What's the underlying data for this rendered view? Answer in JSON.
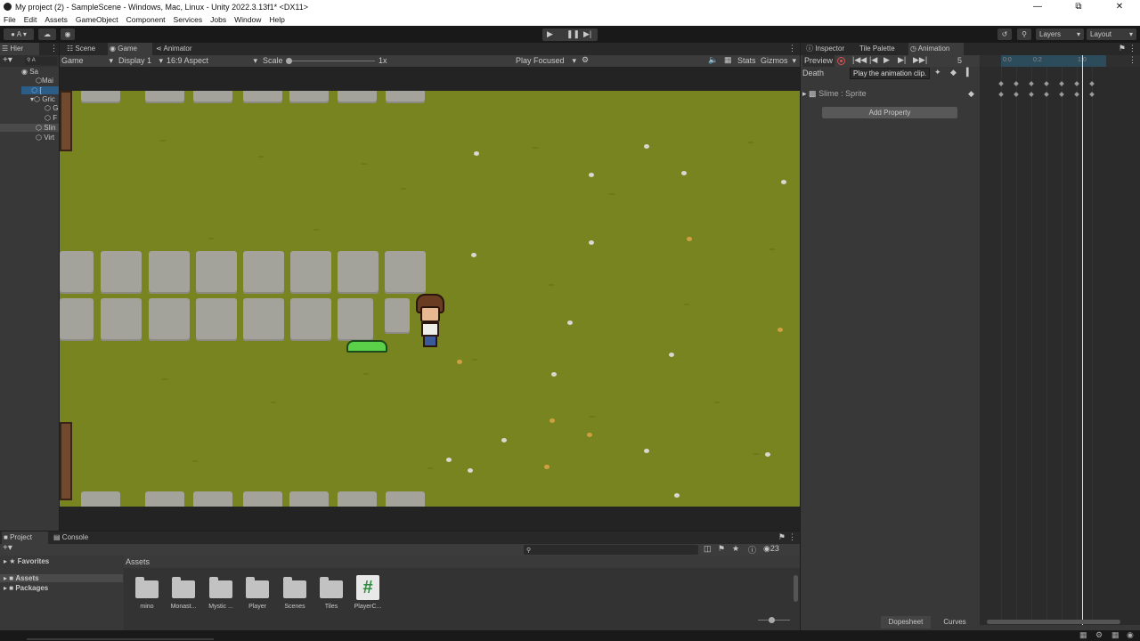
{
  "window": {
    "title": "My project (2) - SampleScene - Windows, Mac, Linux - Unity 2022.3.13f1* <DX11>",
    "minimize": "—",
    "maximize": "⧉",
    "close": "✕"
  },
  "menu": [
    "File",
    "Edit",
    "Assets",
    "GameObject",
    "Component",
    "Services",
    "Jobs",
    "Window",
    "Help"
  ],
  "toolbar": {
    "account_label": "A",
    "layers_label": "Layers",
    "layout_label": "Layout"
  },
  "hierarchy": {
    "tab_label": "Hier",
    "search_label": "A",
    "rows": [
      "Sa",
      "Mai",
      "[",
      "Gric",
      "G",
      "F",
      "Slin",
      "Virt"
    ]
  },
  "game_view": {
    "tabs": [
      "Scene",
      "Game",
      "Animator"
    ],
    "mode_label": "Game",
    "display_label": "Display 1",
    "aspect_label": "16:9 Aspect",
    "scale_label": "Scale",
    "scale_value": "1x",
    "play_focused_label": "Play Focused",
    "stats_label": "Stats",
    "gizmos_label": "Gizmos"
  },
  "animation": {
    "tabs": [
      "Inspector",
      "Tile Palette",
      "Animation"
    ],
    "preview_label": "Preview",
    "frame_value": "5",
    "clip_name": "Death",
    "tooltip": "Play the animation clip.",
    "property_label": "Slime : Sprite",
    "add_property_label": "Add Property",
    "timeline_ticks": [
      "0:0",
      "0:2",
      "1:0"
    ],
    "dopesheet_label": "Dopesheet",
    "curves_label": "Curves"
  },
  "project": {
    "tabs": [
      "Project",
      "Console"
    ],
    "favorites_label": "Favorites",
    "assets_label": "Assets",
    "packages_label": "Packages",
    "breadcrumb": "Assets",
    "hidden_count": "23",
    "items": [
      {
        "label": "mino",
        "type": "folder"
      },
      {
        "label": "Monast...",
        "type": "folder"
      },
      {
        "label": "Mystic ...",
        "type": "folder"
      },
      {
        "label": "Player",
        "type": "folder"
      },
      {
        "label": "Scenes",
        "type": "folder"
      },
      {
        "label": "Tiles",
        "type": "folder"
      },
      {
        "label": "PlayerC...",
        "type": "script"
      }
    ]
  },
  "colors": {
    "grass": "#77841f",
    "stone": "#a3a39b",
    "editor_bg": "#383838",
    "record_red": "#e05050"
  }
}
